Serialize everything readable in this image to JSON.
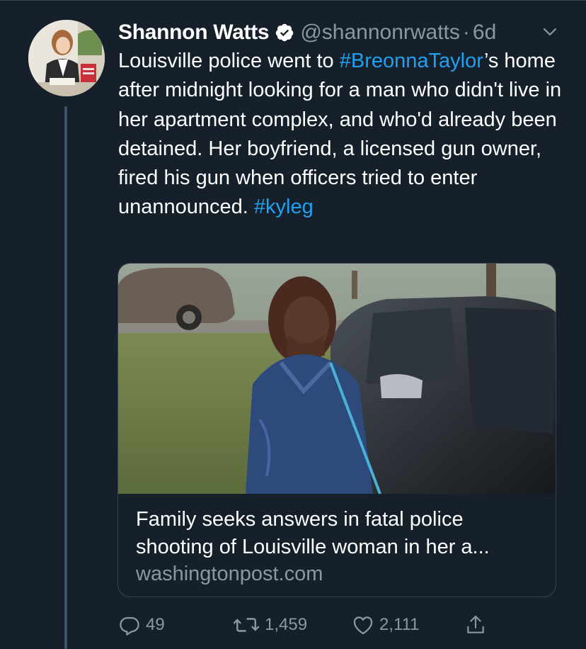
{
  "tweet": {
    "author": {
      "display_name": "Shannon Watts",
      "handle": "@shannonrwatts",
      "separator": "·",
      "time": "6d"
    },
    "text": {
      "part1": "Louisville police went to ",
      "hashtag1": "#BreonnaTaylor",
      "part2": "’s home after midnight looking for a man who didn't live in her apartment complex, and who'd already been detained. Her boyfriend, a licensed gun owner, fired his gun when officers tried to enter unannounced. ",
      "hashtag2": "#kyleg"
    },
    "card": {
      "title_line1": "Family seeks answers in fatal police",
      "title_line2": "shooting of Louisville woman in her a...",
      "domain": "washingtonpost.com"
    },
    "actions": {
      "replies": "49",
      "retweets": "1,459",
      "likes": "2,111"
    }
  },
  "icons": {
    "verified": "verified-badge-icon",
    "menu": "chevron-down-icon",
    "reply": "reply-icon",
    "retweet": "retweet-icon",
    "like": "heart-icon",
    "share": "share-icon"
  },
  "colors": {
    "background": "#15202b",
    "link": "#1da1f2",
    "secondary_text": "#8899a6",
    "border": "#38444d"
  }
}
